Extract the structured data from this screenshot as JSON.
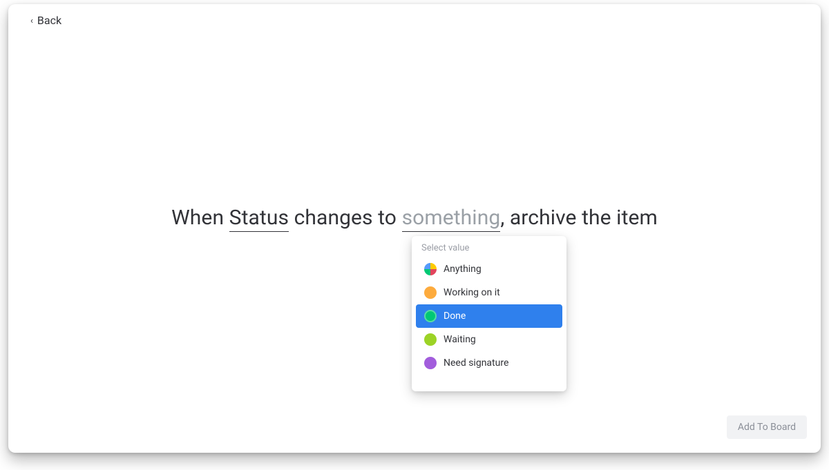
{
  "header": {
    "back_label": "Back"
  },
  "sentence": {
    "prefix": "When ",
    "status_token": "Status",
    "middle": " changes to ",
    "value_token": "something",
    "suffix": ", archive the item"
  },
  "dropdown": {
    "title": "Select value",
    "selected_index": 2,
    "options": [
      {
        "label": "Anything",
        "color": "multi"
      },
      {
        "label": "Working on it",
        "color": "#fdab3d"
      },
      {
        "label": "Done",
        "color": "#00c875"
      },
      {
        "label": "Waiting",
        "color": "#9cd326"
      },
      {
        "label": "Need signature",
        "color": "#a25ddc"
      }
    ]
  },
  "footer": {
    "add_button": "Add To Board"
  }
}
